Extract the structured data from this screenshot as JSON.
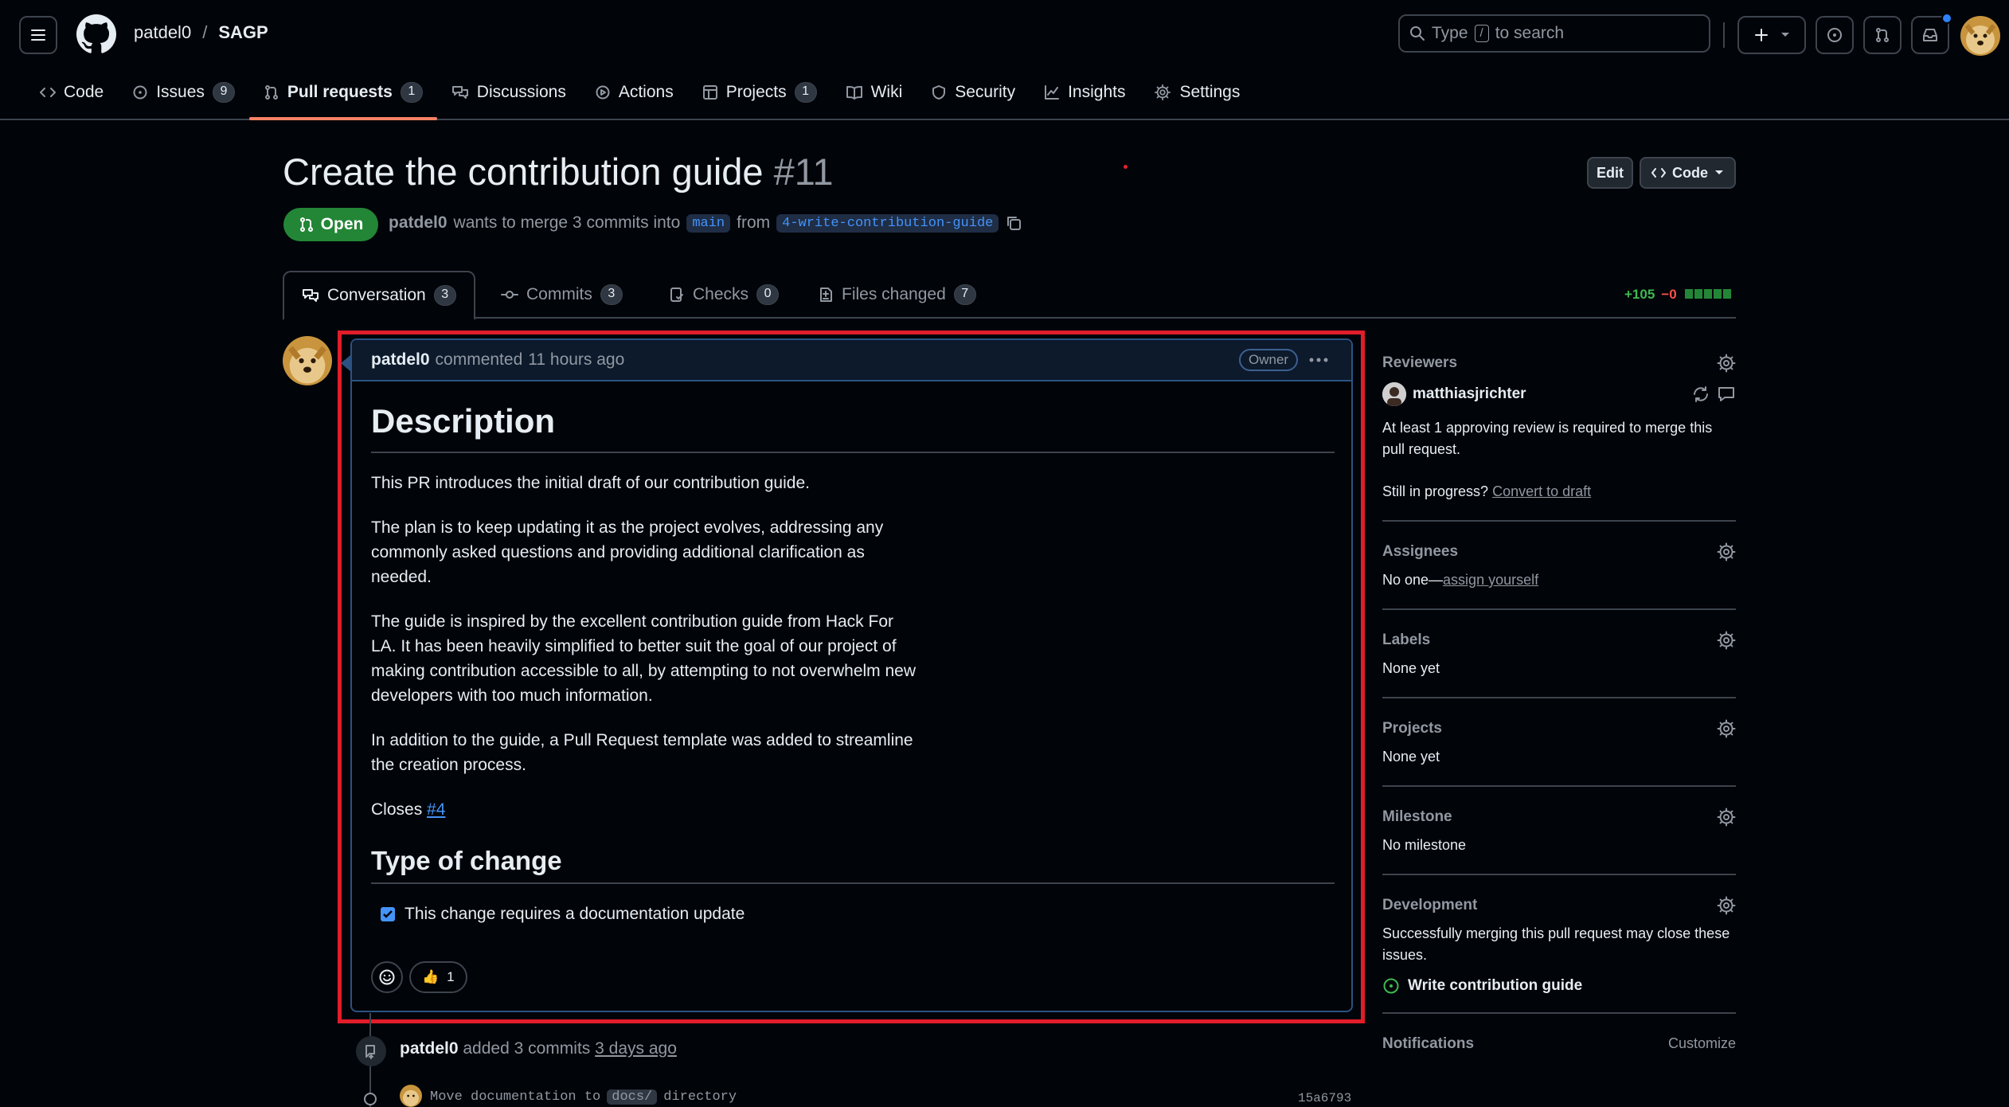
{
  "header": {
    "owner": "patdel0",
    "separator": "/",
    "repo": "SAGP",
    "search_placeholder_pre": "Type",
    "search_key": "/",
    "search_placeholder_post": "to search"
  },
  "repo_nav": [
    {
      "label": "Code",
      "icon": "code-icon"
    },
    {
      "label": "Issues",
      "count": "9",
      "icon": "issue-icon"
    },
    {
      "label": "Pull requests",
      "count": "1",
      "icon": "pr-icon",
      "active": true
    },
    {
      "label": "Discussions",
      "icon": "discussion-icon"
    },
    {
      "label": "Actions",
      "icon": "play-icon"
    },
    {
      "label": "Projects",
      "count": "1",
      "icon": "table-icon"
    },
    {
      "label": "Wiki",
      "icon": "book-icon"
    },
    {
      "label": "Security",
      "icon": "shield-icon"
    },
    {
      "label": "Insights",
      "icon": "graph-icon"
    },
    {
      "label": "Settings",
      "icon": "gear-icon"
    }
  ],
  "pr": {
    "title": "Create the contribution guide",
    "number": "#11",
    "state": "Open",
    "author": "patdel0",
    "meta_mid": "wants to merge 3 commits into",
    "base_branch": "main",
    "from": "from",
    "head_branch": "4-write-contribution-guide",
    "edit_label": "Edit",
    "code_label": "Code"
  },
  "pr_tabs": [
    {
      "label": "Conversation",
      "count": "3",
      "active": true
    },
    {
      "label": "Commits",
      "count": "3"
    },
    {
      "label": "Checks",
      "count": "0"
    },
    {
      "label": "Files changed",
      "count": "7"
    }
  ],
  "diffstat": {
    "additions": "+105",
    "deletions": "−0"
  },
  "comment": {
    "author": "patdel0",
    "action": "commented",
    "time": "11 hours ago",
    "badge": "Owner",
    "heading1": "Description",
    "p1": "This PR introduces the initial draft of our contribution guide.",
    "p2": "The plan is to keep updating it as the project evolves, addressing any commonly asked questions and providing additional clarification as needed.",
    "p3": "The guide is inspired by the excellent contribution guide from Hack For LA. It has been heavily simplified to better suit the goal of our project of making contribution accessible to all, by attempting to not overwhelm new developers with too much information.",
    "p4": "In addition to the guide, a Pull Request template was added to streamline the creation process.",
    "closes_label": "Closes",
    "closes_ref": "#4",
    "heading2": "Type of change",
    "task": "This change requires a documentation update",
    "reaction_emoji": "👍",
    "reaction_count": "1"
  },
  "timeline": {
    "author": "patdel0",
    "text": "added 3 commits",
    "time": "3 days ago",
    "commit_pre": "Move documentation to",
    "commit_code": "docs/",
    "commit_post": "directory",
    "commit_sha": "15a6793"
  },
  "sidebar": {
    "reviewers_title": "Reviewers",
    "reviewer": "matthiasjrichter",
    "review_note": "At least 1 approving review is required to merge this pull request.",
    "draft_pre": "Still in progress?",
    "draft_link": "Convert to draft",
    "assignees_title": "Assignees",
    "assignees_pre": "No one—",
    "assignees_link": "assign yourself",
    "labels_title": "Labels",
    "labels_value": "None yet",
    "projects_title": "Projects",
    "projects_value": "None yet",
    "milestone_title": "Milestone",
    "milestone_value": "No milestone",
    "development_title": "Development",
    "development_note": "Successfully merging this pull request may close these issues.",
    "development_issue": "Write contribution guide",
    "notifications_title": "Notifications",
    "notifications_action": "Customize"
  },
  "colors": {
    "accent_green": "#238636",
    "link_blue": "#4493f8",
    "highlight_red": "#e11d2a",
    "active_tab_underline": "#f78166"
  }
}
